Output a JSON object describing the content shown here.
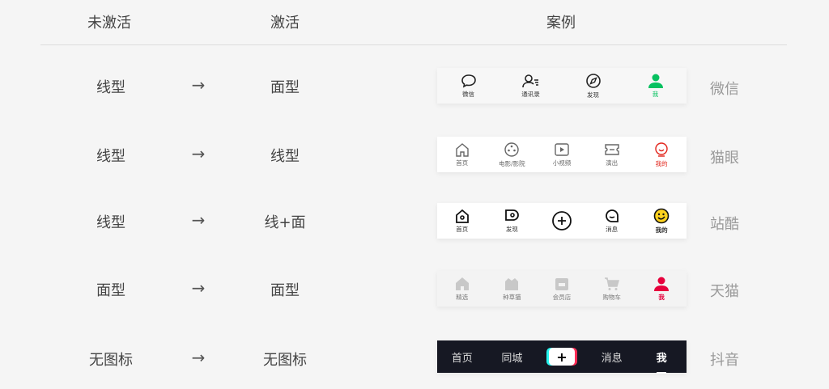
{
  "headers": {
    "inactive": "未激活",
    "active": "激活",
    "example": "案例"
  },
  "arrow": "→",
  "rows": [
    {
      "inactive": "线型",
      "active": "面型",
      "app": "微信",
      "tabs": [
        {
          "label": "微信",
          "icon": "chat-bubble-icon"
        },
        {
          "label": "通讯录",
          "icon": "contacts-icon"
        },
        {
          "label": "发现",
          "icon": "compass-icon"
        },
        {
          "label": "我",
          "icon": "person-icon",
          "active": true
        }
      ]
    },
    {
      "inactive": "线型",
      "active": "线型",
      "app": "猫眼",
      "tabs": [
        {
          "label": "首页",
          "icon": "home-icon"
        },
        {
          "label": "电影/影院",
          "icon": "film-reel-icon"
        },
        {
          "label": "小视频",
          "icon": "play-icon"
        },
        {
          "label": "演出",
          "icon": "ticket-icon"
        },
        {
          "label": "我的",
          "icon": "face-icon",
          "active": true
        }
      ]
    },
    {
      "inactive": "线型",
      "active": "线+面",
      "app": "站酷",
      "tabs": [
        {
          "label": "首页",
          "icon": "home-icon"
        },
        {
          "label": "发现",
          "icon": "discover-icon"
        },
        {
          "label": "",
          "icon": "plus-circle-icon"
        },
        {
          "label": "消息",
          "icon": "message-icon"
        },
        {
          "label": "我的",
          "icon": "smiley-face-icon",
          "active": true
        }
      ]
    },
    {
      "inactive": "面型",
      "active": "面型",
      "app": "天猫",
      "tabs": [
        {
          "label": "精选",
          "icon": "home-icon"
        },
        {
          "label": "种草猫",
          "icon": "cat-box-icon"
        },
        {
          "label": "会员店",
          "icon": "store-icon"
        },
        {
          "label": "购物车",
          "icon": "cart-icon"
        },
        {
          "label": "我",
          "icon": "person-icon",
          "active": true
        }
      ]
    },
    {
      "inactive": "无图标",
      "active": "无图标",
      "app": "抖音",
      "tabs": [
        {
          "label": "首页"
        },
        {
          "label": "同城"
        },
        {
          "label": "+",
          "icon": "plus-button-icon"
        },
        {
          "label": "消息"
        },
        {
          "label": "我",
          "active": true
        }
      ]
    }
  ],
  "colors": {
    "wechat_green": "#07c160",
    "maoyan_red": "#e2231a",
    "zcool_yellow": "#ffd21e",
    "tmall_red": "#e6003c",
    "douyin_bg": "#161823"
  }
}
